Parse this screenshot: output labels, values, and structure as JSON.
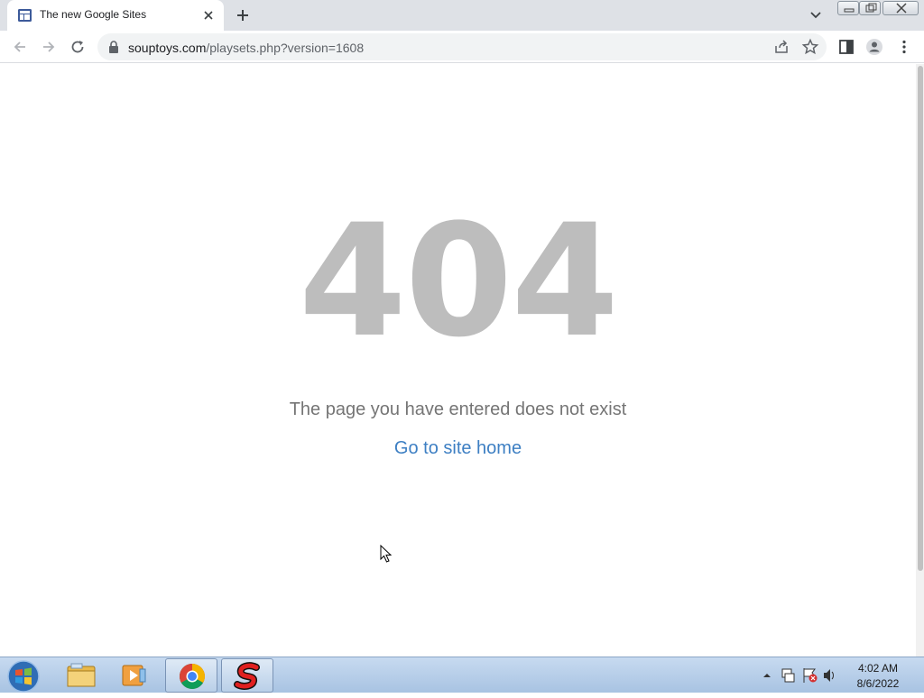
{
  "browser": {
    "tab": {
      "title": "The new Google Sites",
      "favicon": "google-sites-icon"
    },
    "url": {
      "host": "souptoys.com",
      "path": "/playsets.php?version=1608"
    }
  },
  "page": {
    "error_code": "404",
    "message": "The page you have entered does not exist",
    "home_link": "Go to site home"
  },
  "taskbar": {
    "apps": [
      "windows-explorer-icon",
      "media-player-icon",
      "chrome-icon",
      "souptoys-icon"
    ],
    "clock": {
      "time": "4:02 AM",
      "date": "8/6/2022"
    }
  },
  "colors": {
    "error_code": "#bdbdbd",
    "message": "#757575",
    "link": "#3d7fc3",
    "tabstrip": "#dee1e6"
  }
}
